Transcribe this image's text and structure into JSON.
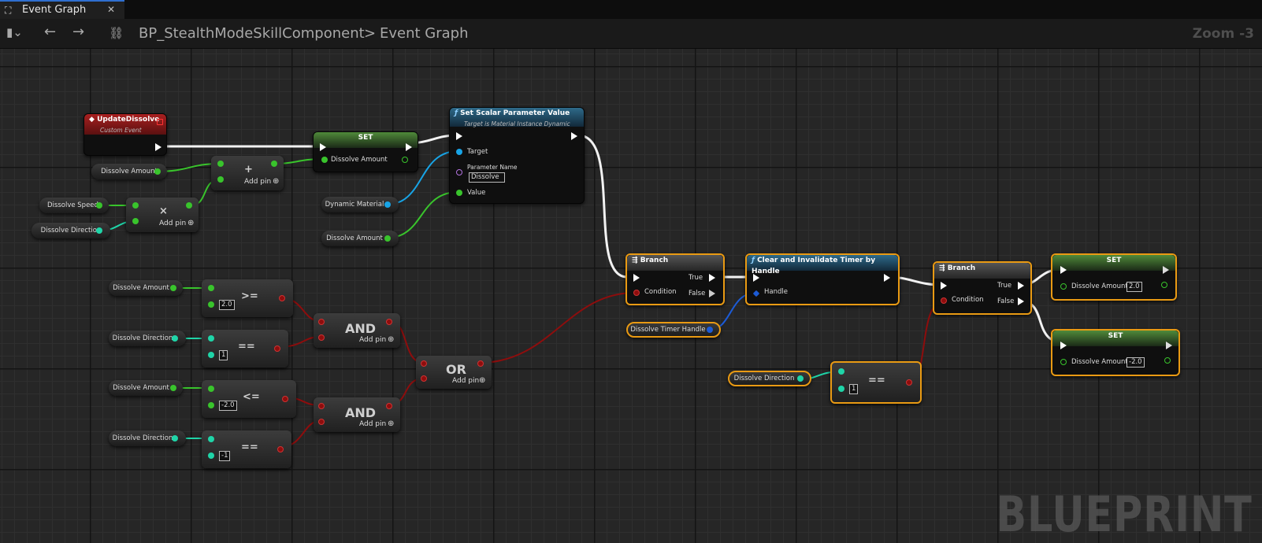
{
  "tab": {
    "icon": "blueprint-graph-icon",
    "label": "Event Graph",
    "close": "✕"
  },
  "toolbar": {
    "bookmark": "▮⌄",
    "back": "←",
    "forward": "→",
    "breadcrumb_1": "BP_StealthModeSkillComponent",
    "separator": ">",
    "breadcrumb_2": "Event Graph",
    "zoom": "Zoom -3"
  },
  "watermark": "BLUEPRINT",
  "colors": {
    "float": "#39c42c",
    "integer": "#1fd5a8",
    "bool": "#8e0d0d",
    "object": "#18a4e6",
    "struct": "#1c5bd6",
    "name": "#b373e0",
    "selected": "#e99a13"
  },
  "nodes": {
    "custom_event": {
      "title": "UpdateDissolve",
      "subtitle": "Custom Event"
    },
    "set_1": {
      "title": "SET",
      "pin": "Dissolve Amount"
    },
    "add": {
      "symbol": "+",
      "add_pin": "Add pin"
    },
    "multiply": {
      "symbol": "×",
      "add_pin": "Add pin"
    },
    "set_scalar": {
      "title": "Set Scalar Parameter Value",
      "subtitle": "Target is Material Instance Dynamic",
      "target": "Target",
      "param_name": "Parameter Name",
      "param_value": "Dissolve",
      "value": "Value"
    },
    "var_dissolve_amount_1": "Dissolve Amount",
    "var_dissolve_speed": "Dissolve Speed",
    "var_dissolve_direction_1": "Dissolve Direction",
    "var_dynamic_material": "Dynamic Material",
    "var_dissolve_amount_2": "Dissolve Amount",
    "var_dissolve_amount_3": "Dissolve Amount",
    "var_dissolve_direction_2": "Dissolve Direction",
    "var_dissolve_amount_4": "Dissolve Amount",
    "var_dissolve_direction_3": "Dissolve Direction",
    "cmp_ge": {
      "symbol": ">=",
      "value": "2.0"
    },
    "cmp_eq_1": {
      "symbol": "==",
      "value": "1"
    },
    "cmp_le": {
      "symbol": "<=",
      "value": "-2.0"
    },
    "cmp_eq_2": {
      "symbol": "==",
      "value": "-1"
    },
    "and_1": {
      "symbol": "AND",
      "add_pin": "Add pin"
    },
    "and_2": {
      "symbol": "AND",
      "add_pin": "Add pin"
    },
    "or": {
      "symbol": "OR",
      "add_pin": "Add pin"
    },
    "branch_1": {
      "title": "Branch",
      "condition": "Condition",
      "true": "True",
      "false": "False"
    },
    "clear_timer": {
      "title": "Clear and Invalidate Timer by Handle",
      "handle": "Handle"
    },
    "var_timer_handle": "Dissolve Timer Handle",
    "var_dissolve_direction_4": "Dissolve Direction",
    "cmp_eq_3": {
      "symbol": "==",
      "value": "1"
    },
    "branch_2": {
      "title": "Branch",
      "condition": "Condition",
      "true": "True",
      "false": "False"
    },
    "set_2": {
      "title": "SET",
      "pin": "Dissolve Amount",
      "value": "2.0"
    },
    "set_3": {
      "title": "SET",
      "pin": "Dissolve Amount",
      "value": "-2.0"
    }
  }
}
